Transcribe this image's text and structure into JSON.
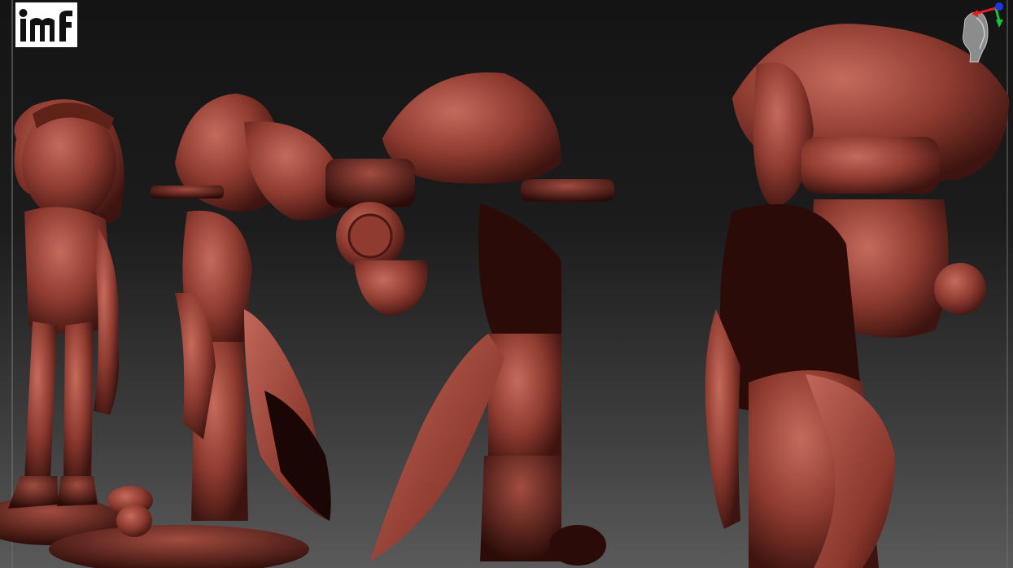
{
  "logo": {
    "text": "IMF",
    "colors": {
      "background": "#ffffff",
      "ink": "#111111"
    }
  },
  "navigation_gizmo": {
    "icon": "head-orientation-gizmo",
    "axis_colors": {
      "x": "#e21f1f",
      "y": "#19c43a",
      "z": "#1c36e6"
    }
  },
  "viewport": {
    "background_top": "#141414",
    "background_bottom": "#5a5a5a",
    "clay_material": "#8f3b30"
  }
}
